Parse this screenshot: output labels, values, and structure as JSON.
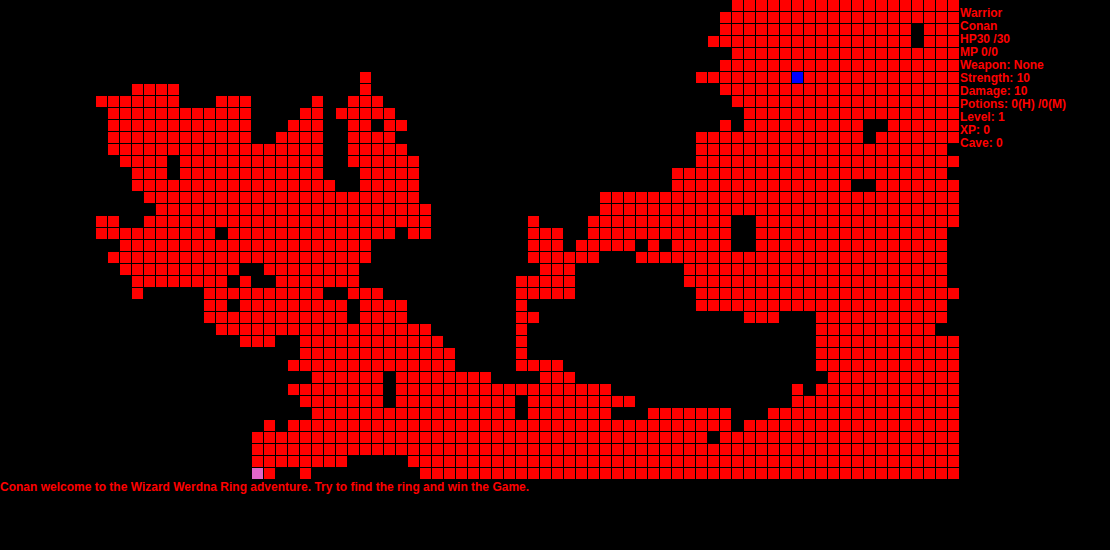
{
  "map": {
    "columns": 80,
    "rows": [
      [
        [
          61,
          79
        ]
      ],
      [
        [
          60,
          79
        ]
      ],
      [
        [
          60,
          75
        ],
        [
          77,
          79
        ]
      ],
      [
        [
          59,
          75
        ],
        [
          77,
          79
        ]
      ],
      [
        [
          61,
          79
        ]
      ],
      [
        [
          60,
          79
        ]
      ],
      [
        [
          30,
          30
        ],
        [
          58,
          79
        ]
      ],
      [
        [
          11,
          14
        ],
        [
          30,
          30
        ],
        [
          60,
          79
        ]
      ],
      [
        [
          8,
          14
        ],
        [
          18,
          20
        ],
        [
          26,
          26
        ],
        [
          29,
          31
        ],
        [
          61,
          79
        ]
      ],
      [
        [
          9,
          20
        ],
        [
          25,
          26
        ],
        [
          28,
          32
        ],
        [
          62,
          79
        ]
      ],
      [
        [
          9,
          20
        ],
        [
          24,
          26
        ],
        [
          29,
          30
        ],
        [
          32,
          33
        ],
        [
          60,
          60
        ],
        [
          62,
          71
        ],
        [
          74,
          79
        ]
      ],
      [
        [
          9,
          20
        ],
        [
          23,
          26
        ],
        [
          29,
          32
        ],
        [
          58,
          71
        ],
        [
          73,
          79
        ]
      ],
      [
        [
          9,
          26
        ],
        [
          29,
          33
        ],
        [
          58,
          78
        ]
      ],
      [
        [
          10,
          13
        ],
        [
          15,
          26
        ],
        [
          29,
          34
        ],
        [
          58,
          79
        ]
      ],
      [
        [
          11,
          13
        ],
        [
          15,
          26
        ],
        [
          30,
          34
        ],
        [
          56,
          78
        ]
      ],
      [
        [
          11,
          27
        ],
        [
          30,
          34
        ],
        [
          56,
          70
        ],
        [
          73,
          79
        ]
      ],
      [
        [
          12,
          34
        ],
        [
          50,
          79
        ]
      ],
      [
        [
          13,
          35
        ],
        [
          50,
          79
        ]
      ],
      [
        [
          8,
          9
        ],
        [
          12,
          35
        ],
        [
          44,
          44
        ],
        [
          49,
          60
        ],
        [
          63,
          79
        ]
      ],
      [
        [
          8,
          17
        ],
        [
          19,
          32
        ],
        [
          34,
          35
        ],
        [
          44,
          46
        ],
        [
          49,
          60
        ],
        [
          63,
          78
        ]
      ],
      [
        [
          10,
          30
        ],
        [
          44,
          46
        ],
        [
          48,
          52
        ],
        [
          54,
          54
        ],
        [
          56,
          60
        ],
        [
          63,
          78
        ]
      ],
      [
        [
          9,
          30
        ],
        [
          44,
          49
        ],
        [
          53,
          78
        ]
      ],
      [
        [
          10,
          19
        ],
        [
          22,
          29
        ],
        [
          45,
          47
        ],
        [
          57,
          78
        ]
      ],
      [
        [
          11,
          18
        ],
        [
          20,
          20
        ],
        [
          23,
          29
        ],
        [
          43,
          47
        ],
        [
          57,
          78
        ]
      ],
      [
        [
          11,
          11
        ],
        [
          17,
          26
        ],
        [
          29,
          31
        ],
        [
          43,
          47
        ],
        [
          58,
          79
        ]
      ],
      [
        [
          17,
          18
        ],
        [
          20,
          28
        ],
        [
          30,
          33
        ],
        [
          43,
          43
        ],
        [
          58,
          78
        ]
      ],
      [
        [
          17,
          28
        ],
        [
          30,
          33
        ],
        [
          43,
          44
        ],
        [
          62,
          64
        ],
        [
          68,
          78
        ]
      ],
      [
        [
          18,
          35
        ],
        [
          43,
          43
        ],
        [
          68,
          77
        ]
      ],
      [
        [
          20,
          22
        ],
        [
          25,
          36
        ],
        [
          43,
          43
        ],
        [
          68,
          79
        ]
      ],
      [
        [
          25,
          37
        ],
        [
          43,
          43
        ],
        [
          68,
          79
        ]
      ],
      [
        [
          24,
          37
        ],
        [
          43,
          46
        ],
        [
          68,
          79
        ]
      ],
      [
        [
          26,
          31
        ],
        [
          33,
          40
        ],
        [
          45,
          47
        ],
        [
          69,
          79
        ]
      ],
      [
        [
          24,
          31
        ],
        [
          33,
          42
        ],
        [
          43,
          50
        ],
        [
          66,
          66
        ],
        [
          68,
          79
        ]
      ],
      [
        [
          25,
          31
        ],
        [
          33,
          42
        ],
        [
          44,
          52
        ],
        [
          66,
          79
        ]
      ],
      [
        [
          26,
          42
        ],
        [
          44,
          50
        ],
        [
          54,
          60
        ],
        [
          64,
          79
        ]
      ],
      [
        [
          22,
          22
        ],
        [
          24,
          60
        ],
        [
          62,
          79
        ]
      ],
      [
        [
          21,
          58
        ],
        [
          60,
          79
        ]
      ],
      [
        [
          21,
          79
        ]
      ],
      [
        [
          21,
          28
        ],
        [
          34,
          79
        ]
      ],
      [
        [
          21,
          22
        ],
        [
          25,
          25
        ],
        [
          35,
          79
        ]
      ]
    ],
    "markers": [
      {
        "kind": "player",
        "row": 6,
        "col": 66,
        "color": "#0000ff"
      },
      {
        "kind": "exit",
        "row": 39,
        "col": 21,
        "color": "#e066c8"
      }
    ]
  },
  "stats": [
    "Warrior",
    "Conan",
    "HP30 /30",
    "MP 0/0",
    "Weapon: None",
    "Strength: 10",
    "Damage: 10",
    "Potions: 0(H) /0(M)",
    "Level: 1",
    "XP: 0",
    "Cave: 0"
  ],
  "message": "Conan welcome to the Wizard Werdna Ring adventure. Try to find the ring and win the Game."
}
